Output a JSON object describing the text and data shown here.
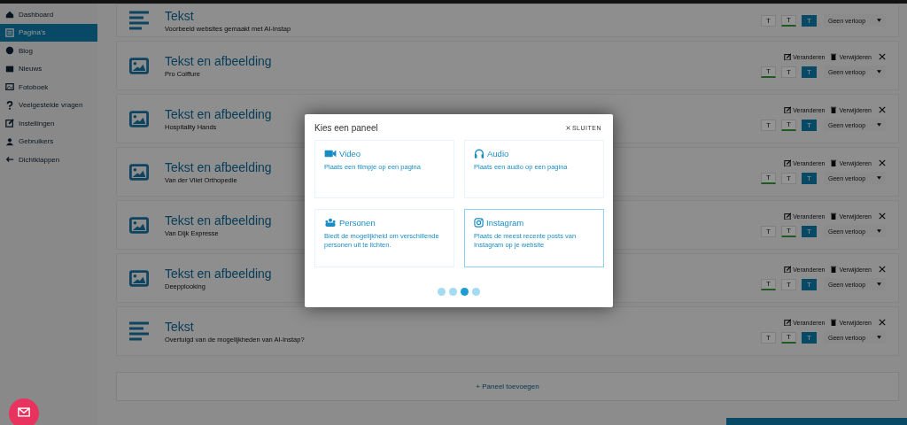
{
  "sidebar": {
    "items": [
      {
        "label": "Dashboard",
        "selected": false
      },
      {
        "label": "Pagina's",
        "selected": true
      },
      {
        "label": "Blog",
        "selected": false
      },
      {
        "label": "Nieuws",
        "selected": false
      },
      {
        "label": "Fotoboek",
        "selected": false
      },
      {
        "label": "Veelgestelde vragen",
        "selected": false
      },
      {
        "label": "Instellingen",
        "selected": false
      },
      {
        "label": "Gebruikers",
        "selected": false
      },
      {
        "label": "Dichtklappen",
        "selected": false
      }
    ]
  },
  "panels": [
    {
      "kind": "text",
      "title": "Tekst",
      "subtitle": "Voorbeeld websites gemaakt met AI-Instap",
      "align": [
        {
          "label": "T",
          "selected": false
        },
        {
          "label": "T",
          "selected": true
        },
        {
          "label": "T",
          "selected": false
        }
      ],
      "transition": "Geen verloop"
    },
    {
      "kind": "image",
      "title": "Tekst en afbeelding",
      "subtitle": "Pro Coiffure",
      "actions": [
        "Veranderen",
        "Verwijderen"
      ],
      "align": [
        {
          "label": "T",
          "selected": true
        },
        {
          "label": "T",
          "selected": false
        },
        {
          "label": "T",
          "selected": false
        }
      ],
      "transition": "Geen verloop"
    },
    {
      "kind": "image",
      "title": "Tekst en afbeelding",
      "subtitle": "Hospitality Hands",
      "actions": [
        "Veranderen",
        "Verwijderen"
      ],
      "align": [
        {
          "label": "T",
          "selected": false
        },
        {
          "label": "T",
          "selected": true
        },
        {
          "label": "T",
          "selected": false
        }
      ],
      "transition": "Geen verloop"
    },
    {
      "kind": "image",
      "title": "Tekst en afbeelding",
      "subtitle": "Van der Vliet Orthopedie",
      "actions": [
        "Veranderen",
        "Verwijderen"
      ],
      "align": [
        {
          "label": "T",
          "selected": true
        },
        {
          "label": "T",
          "selected": false
        },
        {
          "label": "T",
          "selected": false
        }
      ],
      "transition": "Geen verloop"
    },
    {
      "kind": "image",
      "title": "Tekst en afbeelding",
      "subtitle": "Van Dijk Expresse",
      "actions": [
        "Veranderen",
        "Verwijderen"
      ],
      "align": [
        {
          "label": "T",
          "selected": false
        },
        {
          "label": "T",
          "selected": true
        },
        {
          "label": "T",
          "selected": false
        }
      ],
      "transition": "Geen verloop"
    },
    {
      "kind": "image",
      "title": "Tekst en afbeelding",
      "subtitle": "Deepplooking",
      "actions": [
        "Veranderen",
        "Verwijderen"
      ],
      "align": [
        {
          "label": "T",
          "selected": true
        },
        {
          "label": "T",
          "selected": false
        },
        {
          "label": "T",
          "selected": false
        }
      ],
      "transition": "Geen verloop"
    },
    {
      "kind": "text",
      "title": "Tekst",
      "subtitle": "Overtuigd van de mogelijkheden van AI-Instap?",
      "actions": [
        "Veranderen",
        "Verwijderen"
      ],
      "align": [
        {
          "label": "T",
          "selected": false
        },
        {
          "label": "T",
          "selected": true
        },
        {
          "label": "T",
          "selected": false
        }
      ],
      "transition": "Geen verloop"
    }
  ],
  "add_panel_button": {
    "icon": "+",
    "label": "Paneel toevoegen"
  },
  "modal": {
    "title": "Kies een paneel",
    "close": "SLUITEN",
    "cards": [
      {
        "title": "Video",
        "description": "Plaats een filmpje op een pagina",
        "selected": false
      },
      {
        "title": "Audio",
        "description": "Plaats een audio op een pagina",
        "selected": false
      },
      {
        "title": "Personen",
        "description": "Biedt de mogelijkheid om verschillende personen uit te lichten.",
        "selected": false
      },
      {
        "title": "Instagram",
        "description": "Plaats de meest recente posts van Instagram op je website",
        "selected": true
      }
    ],
    "pages": [
      {
        "selected": false
      },
      {
        "selected": false
      },
      {
        "selected": true
      },
      {
        "selected": false
      }
    ]
  }
}
